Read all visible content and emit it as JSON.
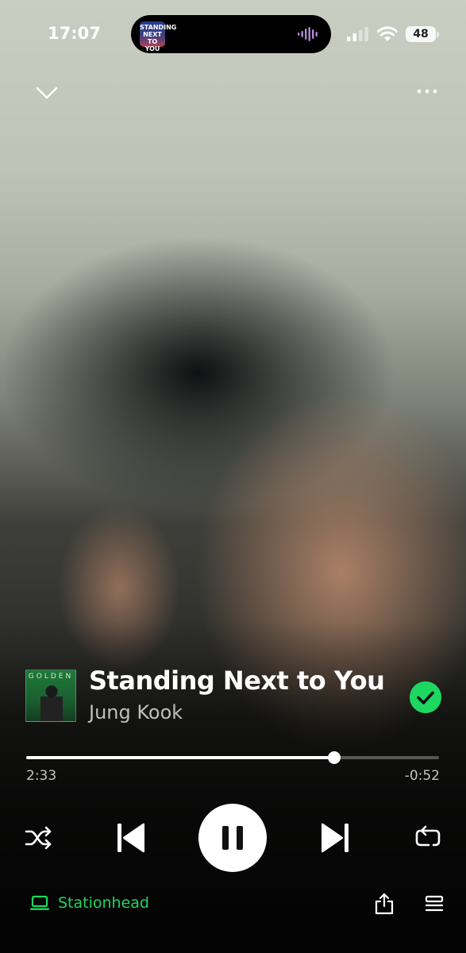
{
  "status_bar": {
    "time": "17:07",
    "battery": "48",
    "island_art_text": "STANDING NEXT TO YOU"
  },
  "top_bar": {
    "collapse_icon": "chevron-down-icon",
    "more_icon": "more-horizontal-icon"
  },
  "track": {
    "album_art_text": "GOLDEN",
    "title": "Standing Next to You",
    "artist": "Jung Kook",
    "saved": true,
    "saved_icon": "check-circle-icon"
  },
  "playback": {
    "elapsed": "2:33",
    "remaining": "-0:52",
    "progress_fraction": 0.746,
    "is_playing": true
  },
  "controls": {
    "shuffle_icon": "shuffle-icon",
    "previous_icon": "skip-previous-icon",
    "pause_icon": "pause-icon",
    "next_icon": "skip-next-icon",
    "repeat_icon": "repeat-icon"
  },
  "bottom_bar": {
    "device_label": "Stationhead",
    "device_icon": "laptop-icon",
    "share_icon": "share-icon",
    "queue_icon": "queue-icon"
  },
  "colors": {
    "accent": "#1ed760",
    "text_primary": "#ffffff"
  }
}
